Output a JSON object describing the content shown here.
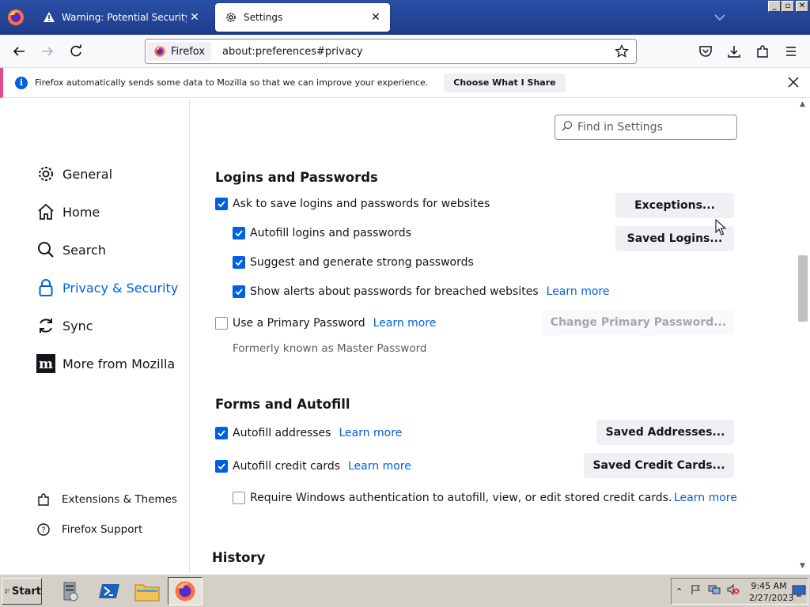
{
  "tabs": [
    {
      "title": "Warning: Potential Security Risk Ahead",
      "icon": "warning-icon",
      "active": false
    },
    {
      "title": "Settings",
      "icon": "gear-icon",
      "active": true
    }
  ],
  "navbar": {
    "identity_label": "Firefox",
    "url": "about:preferences#privacy"
  },
  "notification": {
    "text": "Firefox automatically sends some data to Mozilla so that we can improve your experience.",
    "button": "Choose What I Share"
  },
  "sidebar": {
    "categories": [
      {
        "label": "General",
        "icon": "gear-icon"
      },
      {
        "label": "Home",
        "icon": "home-icon"
      },
      {
        "label": "Search",
        "icon": "search-icon"
      },
      {
        "label": "Privacy & Security",
        "icon": "lock-icon",
        "selected": true
      },
      {
        "label": "Sync",
        "icon": "sync-icon"
      },
      {
        "label": "More from Mozilla",
        "icon": "mozilla-icon"
      }
    ],
    "footer": [
      {
        "label": "Extensions & Themes",
        "icon": "puzzle-icon"
      },
      {
        "label": "Firefox Support",
        "icon": "help-icon"
      }
    ]
  },
  "search": {
    "placeholder": "Find in Settings"
  },
  "logins": {
    "heading": "Logins and Passwords",
    "ask_save": "Ask to save logins and passwords for websites",
    "autofill": "Autofill logins and passwords",
    "suggest": "Suggest and generate strong passwords",
    "alerts": "Show alerts about passwords for breached websites",
    "alerts_link": "Learn more",
    "primary": "Use a Primary Password",
    "primary_link": "Learn more",
    "formerly": "Formerly known as Master Password",
    "exceptions_btn": "Exceptions...",
    "saved_logins_btn": "Saved Logins...",
    "change_primary_btn": "Change Primary Password..."
  },
  "forms": {
    "heading": "Forms and Autofill",
    "addresses": "Autofill addresses",
    "addresses_link": "Learn more",
    "cards": "Autofill credit cards",
    "cards_link": "Learn more",
    "require_auth": "Require Windows authentication to autofill, view, or edit stored credit cards.",
    "require_auth_link": "Learn more",
    "saved_addresses_btn": "Saved Addresses...",
    "saved_cards_btn": "Saved Credit Cards..."
  },
  "history": {
    "heading": "History"
  },
  "taskbar": {
    "start": "Start",
    "time": "9:45 AM",
    "date": "2/27/2023"
  },
  "colors": {
    "accent": "#0061e0",
    "titlebar": "#1f3c8a",
    "notif_bar": "#e34b8f"
  }
}
